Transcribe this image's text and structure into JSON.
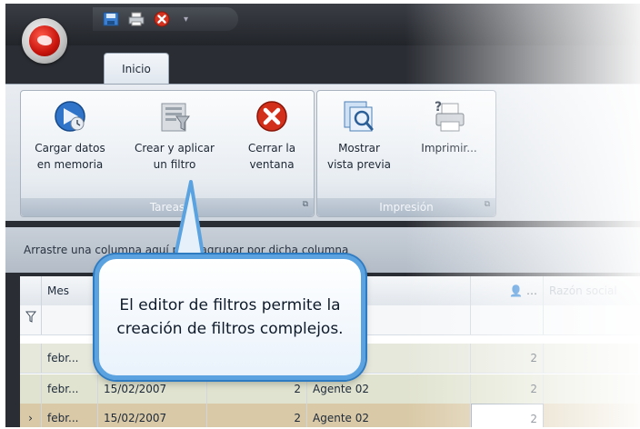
{
  "quick_access": {
    "icons": [
      "save-icon",
      "print-icon",
      "close-icon"
    ],
    "dropdown": "▾"
  },
  "tabs": [
    {
      "label": "Inicio"
    }
  ],
  "ribbon": {
    "groups": [
      {
        "label": "Tareas",
        "buttons": [
          {
            "line1": "Cargar datos",
            "line2": "en memoria",
            "icon": "load-data-icon"
          },
          {
            "line1": "Crear y aplicar",
            "line2": "un filtro",
            "icon": "filter-icon"
          },
          {
            "line1": "Cerrar la",
            "line2": "ventana",
            "icon": "close-window-icon"
          }
        ]
      },
      {
        "label": "Impresión",
        "buttons": [
          {
            "line1": "Mostrar",
            "line2": "vista previa",
            "icon": "print-preview-icon"
          },
          {
            "line1": "Imprimir...",
            "line2": "",
            "icon": "printer-icon"
          }
        ]
      }
    ]
  },
  "grid": {
    "group_panel_text": "Arrastre una columna aquí para agrupar por dicha columna",
    "headers": [
      "Mes",
      "",
      "",
      "",
      "…",
      "Razón social"
    ],
    "rows": [
      {
        "mes": "febr...",
        "fecha": "",
        "num": "",
        "agente": "",
        "val": "2"
      },
      {
        "mes": "febr...",
        "fecha": "15/02/2007",
        "num": "2",
        "agente": "Agente 02",
        "val": "2"
      },
      {
        "mes": "febr...",
        "fecha": "15/02/2007",
        "num": "2",
        "agente": "Agente 02",
        "val": "2"
      }
    ]
  },
  "callout": {
    "text": "El editor de filtros permite la creación de filtros complejos."
  },
  "colors": {
    "callout_border": "#5aa3e0",
    "orb_red": "#c8140c"
  }
}
